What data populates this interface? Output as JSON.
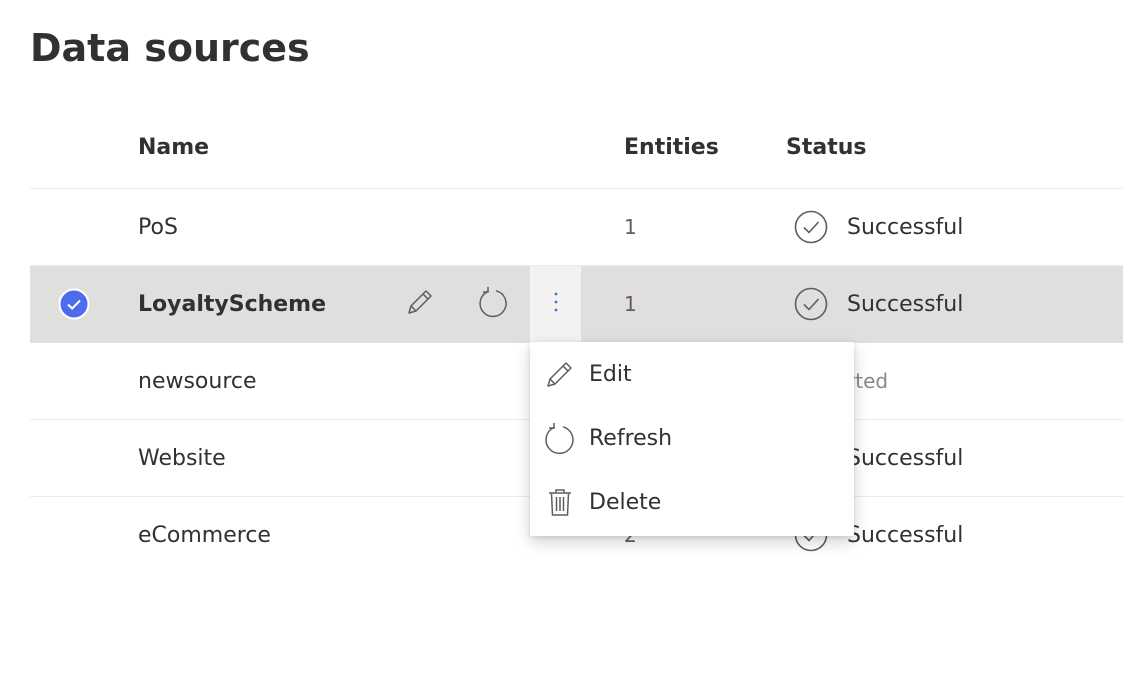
{
  "page": {
    "title": "Data sources"
  },
  "table": {
    "columns": {
      "name": "Name",
      "entities": "Entities",
      "status": "Status"
    },
    "rows": [
      {
        "name": "PoS",
        "entities": "1",
        "status": "Successful",
        "status_icon": "check-circle-icon",
        "selected": false
      },
      {
        "name": "LoyaltyScheme",
        "entities": "1",
        "status": "Successful",
        "status_icon": "check-circle-icon",
        "selected": true
      },
      {
        "name": "newsource",
        "entities": "",
        "status": "rted",
        "status_icon": "",
        "selected": false
      },
      {
        "name": "Website",
        "entities": "",
        "status": "Successful",
        "status_icon": "",
        "selected": false
      },
      {
        "name": "eCommerce",
        "entities": "2",
        "status": "Successful",
        "status_icon": "check-circle-icon",
        "selected": false
      }
    ]
  },
  "context_menu": {
    "items": [
      {
        "label": "Edit",
        "icon": "pencil-icon"
      },
      {
        "label": "Refresh",
        "icon": "refresh-icon"
      },
      {
        "label": "Delete",
        "icon": "trash-icon"
      }
    ]
  },
  "colors": {
    "accent": "#4f6bed",
    "selected_row": "#e1dfdd",
    "text": "#323130"
  }
}
